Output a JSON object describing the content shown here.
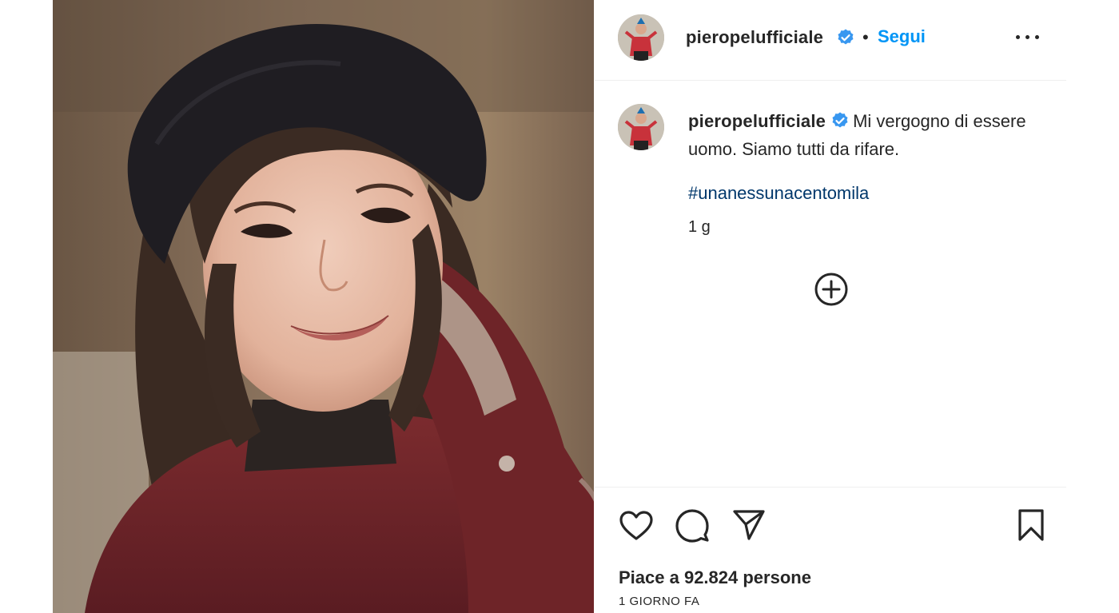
{
  "post": {
    "username": "pieropelufficiale",
    "follow_label": "Segui",
    "separator": "•",
    "caption_text": "Mi vergogno di essere uomo. Siamo tutti da rifare.",
    "hashtag": "#unanessunacentomila",
    "age": "1 g",
    "likes_text": "Piace a 92.824 persone",
    "date_text": "1 GIORNO FA"
  },
  "icons": {
    "verified": "verified-badge-icon",
    "more": "more-options-icon",
    "load_more": "plus-circle-icon",
    "like": "heart-icon",
    "comment": "comment-icon",
    "share": "send-icon",
    "save": "bookmark-icon"
  },
  "colors": {
    "link": "#0095f6",
    "hashtag": "#00376b",
    "verified": "#3897f0",
    "text": "#262626",
    "divider": "#efefef"
  }
}
